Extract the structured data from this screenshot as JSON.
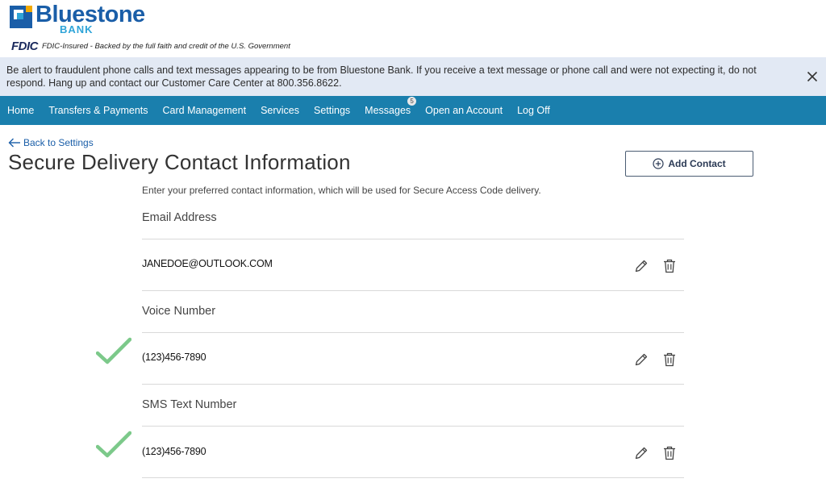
{
  "brand": {
    "name": "Bluestone",
    "sub": "BANK",
    "fdic_logo": "FDIC",
    "fdic_text": "FDIC-Insured - Backed by the full faith and credit of the U.S. Government"
  },
  "alert": {
    "text": "Be alert to fraudulent phone calls and text messages appearing to be from Bluestone Bank. If you receive a text message or phone call and were not expecting it, do not respond. Hang up and contact our Customer Care Center at 800.356.8622."
  },
  "nav": {
    "items": [
      {
        "label": "Home"
      },
      {
        "label": "Transfers & Payments"
      },
      {
        "label": "Card Management"
      },
      {
        "label": "Services"
      },
      {
        "label": "Settings"
      },
      {
        "label": "Messages",
        "badge": "5"
      },
      {
        "label": "Open an Account"
      },
      {
        "label": "Log Off"
      }
    ]
  },
  "page": {
    "back_label": "Back to Settings",
    "title": "Secure Delivery Contact Information",
    "add_label": "Add Contact",
    "intro": "Enter your preferred contact information, which will be used for Secure Access Code delivery."
  },
  "sections": [
    {
      "label": "Email Address",
      "value": "JANEDOE@OUTLOOK.COM",
      "verified": false
    },
    {
      "label": "Voice Number",
      "value": "(123)456-7890",
      "verified": true
    },
    {
      "label": "SMS Text Number",
      "value": "(123)456-7890",
      "verified": true
    }
  ],
  "colors": {
    "brand": "#1a5ea8",
    "nav": "#1a7fad",
    "alert_bg": "#e2e9f4",
    "check": "#7cc98a"
  }
}
